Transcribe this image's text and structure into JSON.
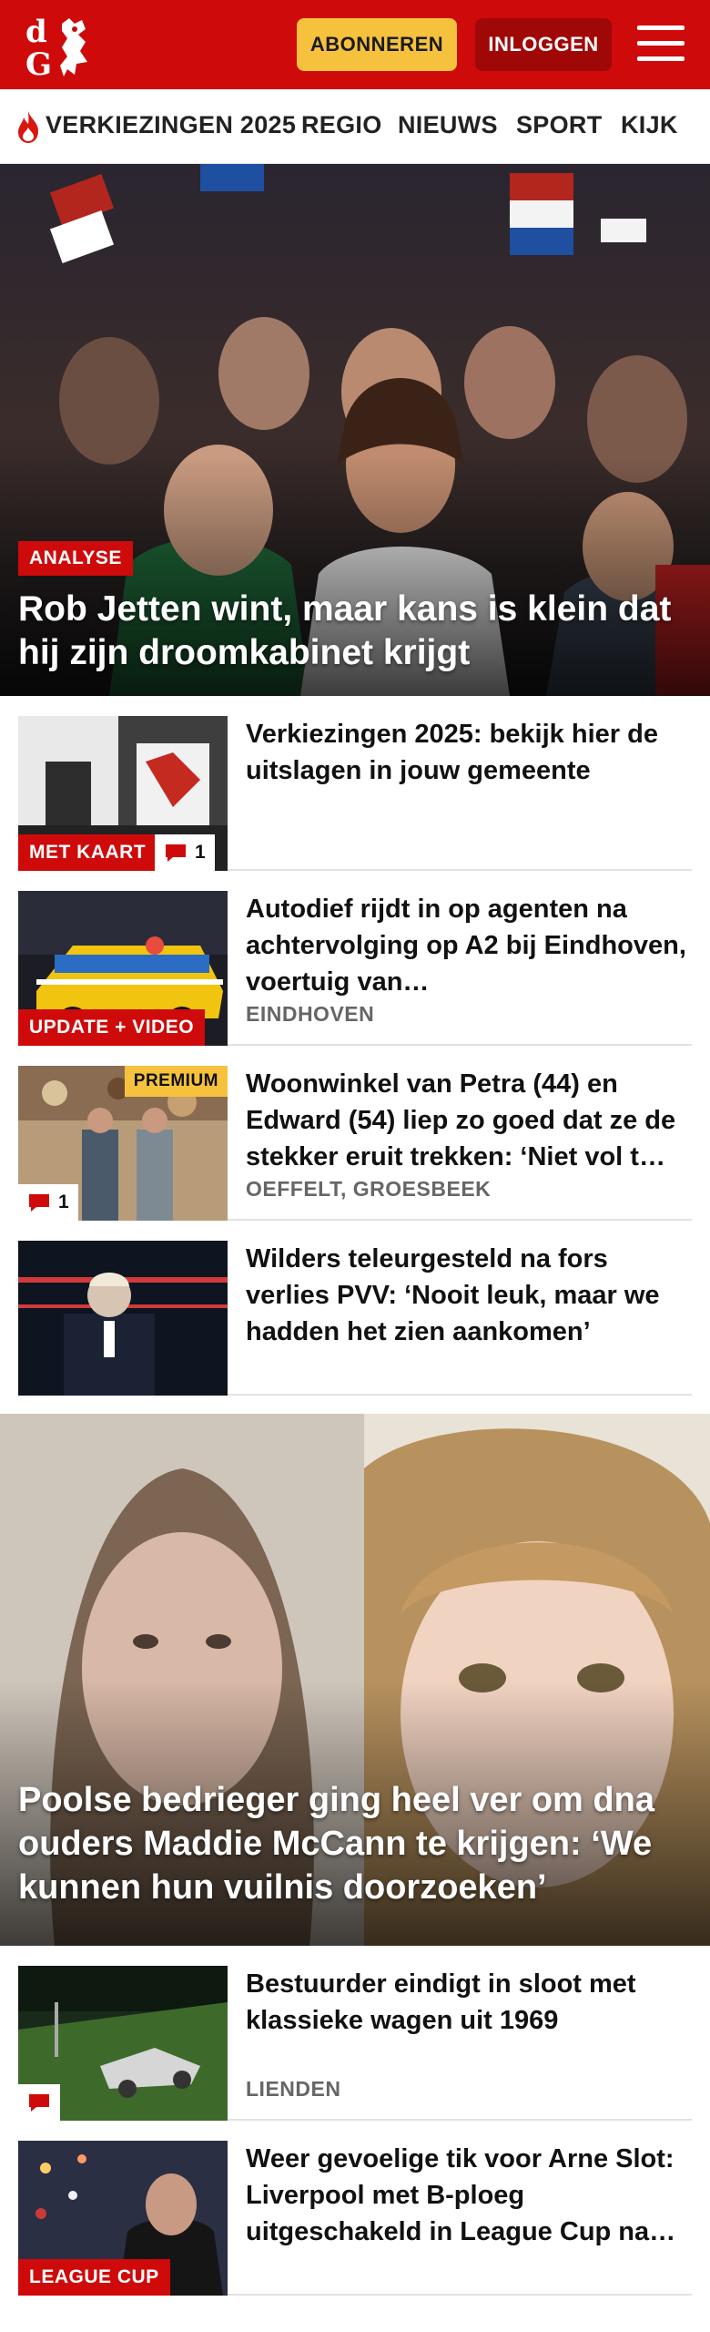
{
  "header": {
    "logo_text": "dG",
    "subscribe_label": "ABONNEREN",
    "login_label": "INLOGGEN",
    "menu_icon": "hamburger-menu-icon",
    "brand_color": "#cf0a0a",
    "accent_color": "#f6c23e"
  },
  "nav": {
    "items": [
      {
        "label": "VERKIEZINGEN 2025",
        "icon": "flame-icon"
      },
      {
        "label": "REGIO"
      },
      {
        "label": "NIEUWS"
      },
      {
        "label": "SPORT"
      },
      {
        "label": "KIJK"
      }
    ]
  },
  "hero": {
    "tag": "ANALYSE",
    "title": "Rob Jetten wint, maar kans is klein dat hij zijn droomkabinet krijgt"
  },
  "articles": [
    {
      "title": "Verkiezingen 2025: bekijk hier de uitslagen in jouw gemeente",
      "tag": "MET KAART",
      "comments": "1",
      "location": ""
    },
    {
      "title": "Autodief rijdt in op agenten na achtervolging op A2 bij Eindhoven, voertuig van…",
      "tag": "UPDATE + VIDEO",
      "location": "EINDHOVEN"
    },
    {
      "title": "Woonwinkel van Petra (44) en Edward (54) liep zo goed dat ze de stekker eruit trekken: ‘Niet vol t…",
      "premium": "PREMIUM",
      "comments": "1",
      "location": "OEFFELT, GROESBEEK"
    },
    {
      "title": "Wilders teleurgesteld na fors verlies PVV: ‘Nooit leuk, maar we hadden het zien aankomen’",
      "location": ""
    }
  ],
  "big_story": {
    "title": "Poolse bedrieger ging heel ver om dna ouders Maddie McCann te krijgen: ‘We kunnen hun vuilnis doorzoeken’"
  },
  "articles2": [
    {
      "title": "Bestuurder eindigt in sloot met klassieke wagen uit 1969",
      "location": "LIENDEN"
    },
    {
      "title": "Weer gevoelige tik voor Arne Slot: Liverpool met B-ploeg uitgeschakeld in League Cup na…",
      "tag": "LEAGUE CUP"
    }
  ]
}
